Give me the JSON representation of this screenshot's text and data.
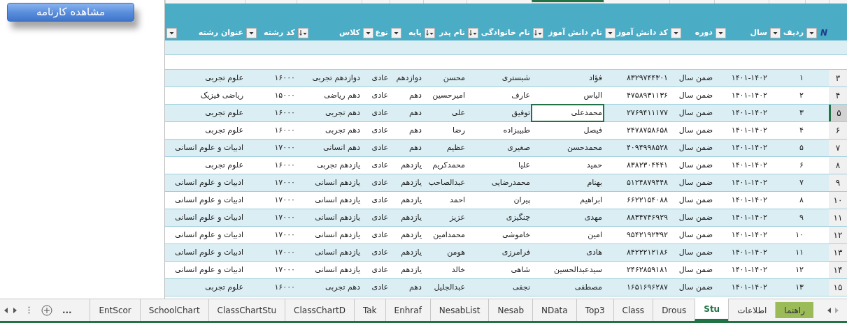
{
  "report_button": {
    "label": "مشاهده کارنامه"
  },
  "columns": [
    {
      "kind": "rownum"
    },
    {
      "kind": "spacer",
      "header": "N",
      "sorted": false,
      "selected": false
    },
    {
      "kind": "data",
      "header": "ردیف",
      "sorted": false,
      "selected": false
    },
    {
      "kind": "data",
      "header": "سال",
      "sorted": false,
      "selected": false
    },
    {
      "kind": "data",
      "header": "دوره",
      "sorted": false,
      "selected": false
    },
    {
      "kind": "data",
      "header": "کد دانش آموز",
      "sorted": false,
      "selected": false
    },
    {
      "kind": "data",
      "header": "نام دانش آموز",
      "sorted": true,
      "selected": true
    },
    {
      "kind": "data",
      "header": "نام خانوادگی",
      "sorted": true,
      "selected": false
    },
    {
      "kind": "data",
      "header": "نام پدر",
      "sorted": true,
      "selected": false
    },
    {
      "kind": "data",
      "header": "پایه",
      "sorted": false,
      "selected": false
    },
    {
      "kind": "data",
      "header": "نوع",
      "sorted": false,
      "selected": false
    },
    {
      "kind": "data",
      "header": "کلاس",
      "sorted": true,
      "selected": false
    },
    {
      "kind": "data",
      "header": "کد رشته",
      "sorted": false,
      "selected": false
    },
    {
      "kind": "data",
      "header": "عنوان رشته",
      "sorted": false,
      "selected": false
    }
  ],
  "rows": [
    {
      "number": "۳",
      "selected": false,
      "cells": [
        "۱",
        "۱۴۰۱-۱۴۰۲",
        "ضمن سال",
        "۸۳۲۹۷۴۴۳۰۱",
        "فؤاد",
        "شبستری",
        "محسن",
        "دوازدهم",
        "عادی",
        "دوازدهم تجربی",
        "۱۶۰۰۰",
        "علوم تجربی"
      ]
    },
    {
      "number": "۴",
      "selected": false,
      "cells": [
        "۲",
        "۱۴۰۱-۱۴۰۲",
        "ضمن سال",
        "۴۷۵۸۹۳۱۱۳۶",
        "الیاس",
        "عارف",
        "امیرحسین",
        "دهم",
        "عادی",
        "دهم ریاضی",
        "۱۵۰۰۰",
        "ریاضی فیزیک"
      ]
    },
    {
      "number": "۵",
      "selected": true,
      "cells": [
        "۳",
        "۱۴۰۱-۱۴۰۲",
        "ضمن سال",
        "۲۷۶۹۴۱۱۱۷۷",
        "محمدعلی",
        "توفیق",
        "علی",
        "دهم",
        "عادی",
        "دهم تجربی",
        "۱۶۰۰۰",
        "علوم تجربی"
      ]
    },
    {
      "number": "۶",
      "selected": false,
      "cells": [
        "۴",
        "۱۴۰۱-۱۴۰۲",
        "ضمن سال",
        "۲۴۷۸۷۵۸۶۵۸",
        "فیصل",
        "طبیبزاده",
        "رضا",
        "دهم",
        "عادی",
        "دهم تجربی",
        "۱۶۰۰۰",
        "علوم تجربی"
      ]
    },
    {
      "number": "۷",
      "selected": false,
      "cells": [
        "۵",
        "۱۴۰۱-۱۴۰۲",
        "ضمن سال",
        "۴۰۹۴۹۹۸۵۲۸",
        "محمدحسن",
        "صغیری",
        "عظیم",
        "دهم",
        "عادی",
        "دهم انسانی",
        "۱۷۰۰۰",
        "ادبیات و علوم انسانی"
      ]
    },
    {
      "number": "۸",
      "selected": false,
      "cells": [
        "۶",
        "۱۴۰۱-۱۴۰۲",
        "ضمن سال",
        "۸۳۸۲۳۰۴۴۴۱",
        "حمید",
        "علیا",
        "محمدکریم",
        "یازدهم",
        "عادی",
        "یازدهم تجربی",
        "۱۶۰۰۰",
        "علوم تجربی"
      ]
    },
    {
      "number": "۹",
      "selected": false,
      "cells": [
        "۷",
        "۱۴۰۱-۱۴۰۲",
        "ضمن سال",
        "۵۱۲۴۸۷۹۴۴۸",
        "بهنام",
        "محمدرضایی",
        "عبدالصاحب",
        "یازدهم",
        "عادی",
        "یازدهم انسانی",
        "۱۷۰۰۰",
        "ادبیات و علوم انسانی"
      ]
    },
    {
      "number": "۱۰",
      "selected": false,
      "cells": [
        "۸",
        "۱۴۰۱-۱۴۰۲",
        "ضمن سال",
        "۶۶۲۲۱۵۴۰۸۸",
        "ابراهیم",
        "پیران",
        "احمد",
        "یازدهم",
        "عادی",
        "یازدهم انسانی",
        "۱۷۰۰۰",
        "ادبیات و علوم انسانی"
      ]
    },
    {
      "number": "۱۱",
      "selected": false,
      "cells": [
        "۹",
        "۱۴۰۱-۱۴۰۲",
        "ضمن سال",
        "۸۸۳۴۷۴۶۹۲۹",
        "مهدی",
        "چنگیزی",
        "عزیز",
        "یازدهم",
        "عادی",
        "یازدهم انسانی",
        "۱۷۰۰۰",
        "ادبیات و علوم انسانی"
      ]
    },
    {
      "number": "۱۲",
      "selected": false,
      "cells": [
        "۱۰",
        "۱۴۰۱-۱۴۰۲",
        "ضمن سال",
        "۹۵۴۲۱۹۲۳۹۲",
        "امین",
        "خاموشی",
        "محمدامین",
        "یازدهم",
        "عادی",
        "یازدهم انسانی",
        "۱۷۰۰۰",
        "ادبیات و علوم انسانی"
      ]
    },
    {
      "number": "۱۳",
      "selected": false,
      "cells": [
        "۱۱",
        "۱۴۰۱-۱۴۰۲",
        "ضمن سال",
        "۸۴۲۲۲۱۲۱۸۶",
        "هادی",
        "فرامرزی",
        "هومن",
        "یازدهم",
        "عادی",
        "یازدهم انسانی",
        "۱۷۰۰۰",
        "ادبیات و علوم انسانی"
      ]
    },
    {
      "number": "۱۴",
      "selected": false,
      "cells": [
        "۱۲",
        "۱۴۰۱-۱۴۰۲",
        "ضمن سال",
        "۲۴۶۲۸۵۹۱۸۱",
        "سیدعبدالحسین",
        "شاهی",
        "خالد",
        "یازدهم",
        "عادی",
        "یازدهم انسانی",
        "۱۷۰۰۰",
        "ادبیات و علوم انسانی"
      ]
    },
    {
      "number": "۱۵",
      "selected": false,
      "cells": [
        "۱۳",
        "۱۴۰۱-۱۴۰۲",
        "ضمن سال",
        "۱۶۵۱۶۹۶۲۸۷",
        "مصطفی",
        "نجفی",
        "عبدالجلیل",
        "دهم",
        "عادی",
        "دهم تجربی",
        "۱۶۰۰۰",
        "علوم تجربی"
      ]
    }
  ],
  "sheet_tabs": [
    {
      "label": "راهنما",
      "selected": false,
      "color": "#9bbb59"
    },
    {
      "label": "اطلاعات",
      "selected": false
    },
    {
      "label": "Stu",
      "selected": true
    },
    {
      "label": "Drous",
      "selected": false
    },
    {
      "label": "Class",
      "selected": false
    },
    {
      "label": "Top3",
      "selected": false
    },
    {
      "label": "NData",
      "selected": false
    },
    {
      "label": "Nesab",
      "selected": false
    },
    {
      "label": "NesabList",
      "selected": false
    },
    {
      "label": "Enhraf",
      "selected": false
    },
    {
      "label": "Tak",
      "selected": false
    },
    {
      "label": "ClassChartD",
      "selected": false
    },
    {
      "label": "ClassChartStu",
      "selected": false
    },
    {
      "label": "SchoolChart",
      "selected": false
    },
    {
      "label": "EntScor",
      "selected": false
    }
  ],
  "more_tabs": "..."
}
